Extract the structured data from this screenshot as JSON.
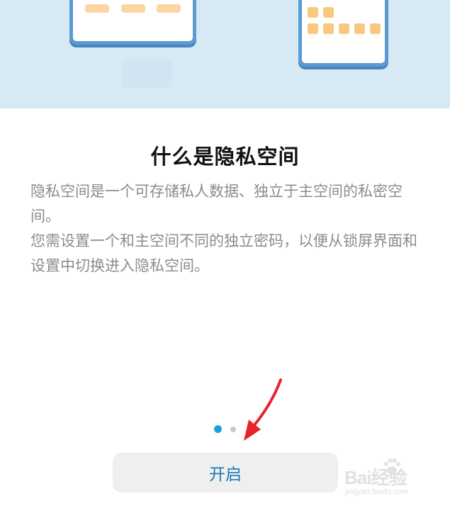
{
  "intro": {
    "title": "什么是隐私空间",
    "description_p1": "隐私空间是一个可存储私人数据、独立于主空间的私密空间。",
    "description_p2": "您需设置一个和主空间不同的独立密码，以便从锁屏界面和设置中切换进入隐私空间。"
  },
  "pager": {
    "pages": 2,
    "current": 1,
    "active_color": "#1fa1d8",
    "inactive_color": "#c8c8c8"
  },
  "action": {
    "enable_label": "开启",
    "label_color": "#1b79b6"
  },
  "watermark": {
    "brand": "Bai经验",
    "url": "jingyan.baidu.com"
  },
  "colors": {
    "illustration_bg": "#d8e9f6",
    "phone_frame": "#5a9bd5",
    "app_tile": "#fbc77e",
    "annotation_arrow": "#e8232a"
  }
}
